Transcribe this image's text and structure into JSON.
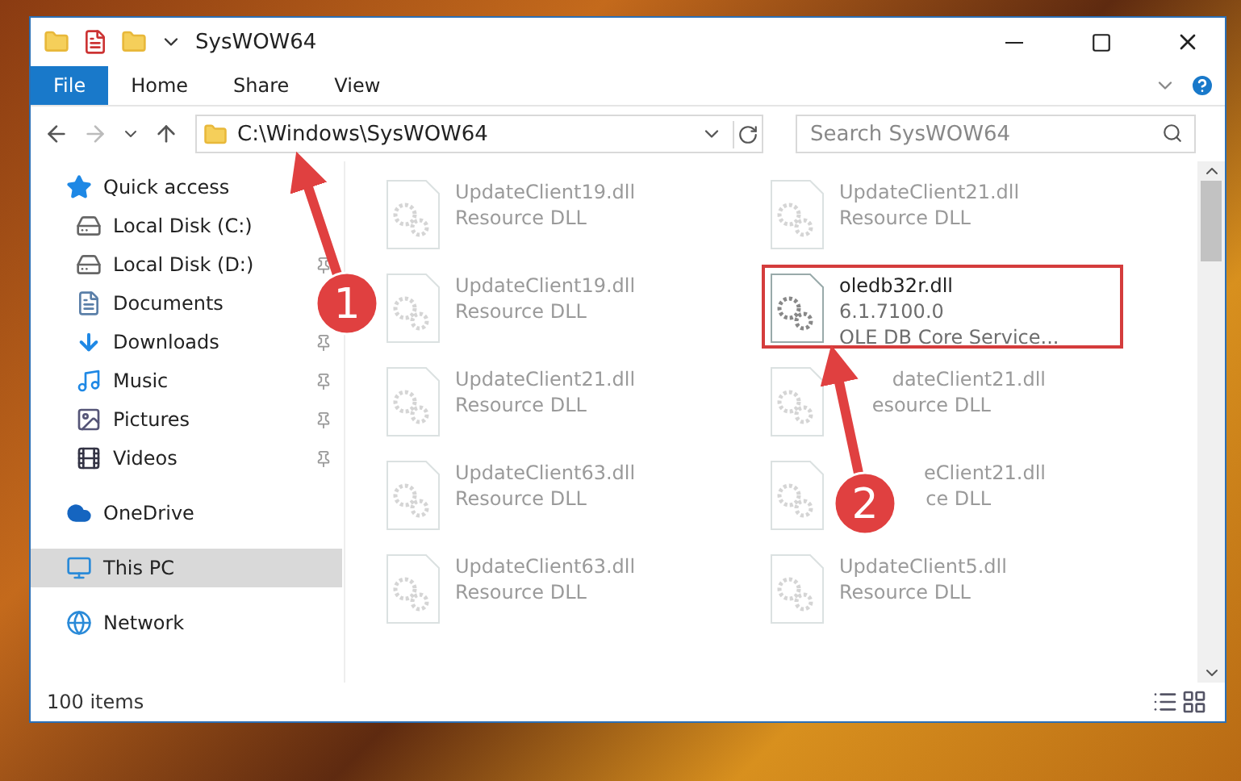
{
  "window": {
    "title": "SysWOW64"
  },
  "ribbon_tabs": [
    {
      "label": "File",
      "selected": true
    },
    {
      "label": "Home",
      "selected": false
    },
    {
      "label": "Share",
      "selected": false
    },
    {
      "label": "View",
      "selected": false
    }
  ],
  "address": {
    "path": "C:\\Windows\\SysWOW64"
  },
  "search": {
    "placeholder": "Search SysWOW64"
  },
  "nav": [
    {
      "label": "Quick access",
      "kind": "star",
      "selected": false,
      "children": [
        {
          "label": "Local Disk (C:)",
          "kind": "disk",
          "pinned": false
        },
        {
          "label": "Local Disk (D:)",
          "kind": "disk",
          "pinned": true
        },
        {
          "label": "Documents",
          "kind": "documents",
          "pinned": false
        },
        {
          "label": "Downloads",
          "kind": "downloads",
          "pinned": true
        },
        {
          "label": "Music",
          "kind": "music",
          "pinned": true
        },
        {
          "label": "Pictures",
          "kind": "pictures",
          "pinned": true
        },
        {
          "label": "Videos",
          "kind": "videos",
          "pinned": true
        }
      ]
    },
    {
      "label": "OneDrive",
      "kind": "cloud",
      "selected": false
    },
    {
      "label": "This PC",
      "kind": "pc",
      "selected": true
    },
    {
      "label": "Network",
      "kind": "network",
      "selected": false
    }
  ],
  "files": [
    {
      "name": "UpdateClient19.dll",
      "details": [
        "Resource DLL"
      ],
      "faded": true
    },
    {
      "name": "UpdateClient21.dll",
      "details": [
        "Resource DLL"
      ],
      "faded": true
    },
    {
      "name": "UpdateClient19.dll",
      "details": [
        "Resource DLL"
      ],
      "faded": true
    },
    {
      "name": "oledb32r.dll",
      "details": [
        "6.1.7100.0",
        "OLE DB Core Service..."
      ],
      "faded": false
    },
    {
      "name": "UpdateClient21.dll",
      "details": [
        "Resource DLL"
      ],
      "faded": true
    },
    {
      "name": "dateClient21.dll",
      "details": [
        "esource DLL"
      ],
      "faded": true,
      "cut": true
    },
    {
      "name": "UpdateClient63.dll",
      "details": [
        "Resource DLL"
      ],
      "faded": true
    },
    {
      "name": "eClient21.dll",
      "details": [
        "ce DLL"
      ],
      "faded": true,
      "cut": true
    },
    {
      "name": "UpdateClient63.dll",
      "details": [
        "Resource DLL"
      ],
      "faded": true
    },
    {
      "name": "UpdateClient5.dll",
      "details": [
        "Resource DLL"
      ],
      "faded": true
    }
  ],
  "status_bar": {
    "count": "100 items"
  },
  "annotations": [
    {
      "number": "1"
    },
    {
      "number": "2"
    }
  ]
}
